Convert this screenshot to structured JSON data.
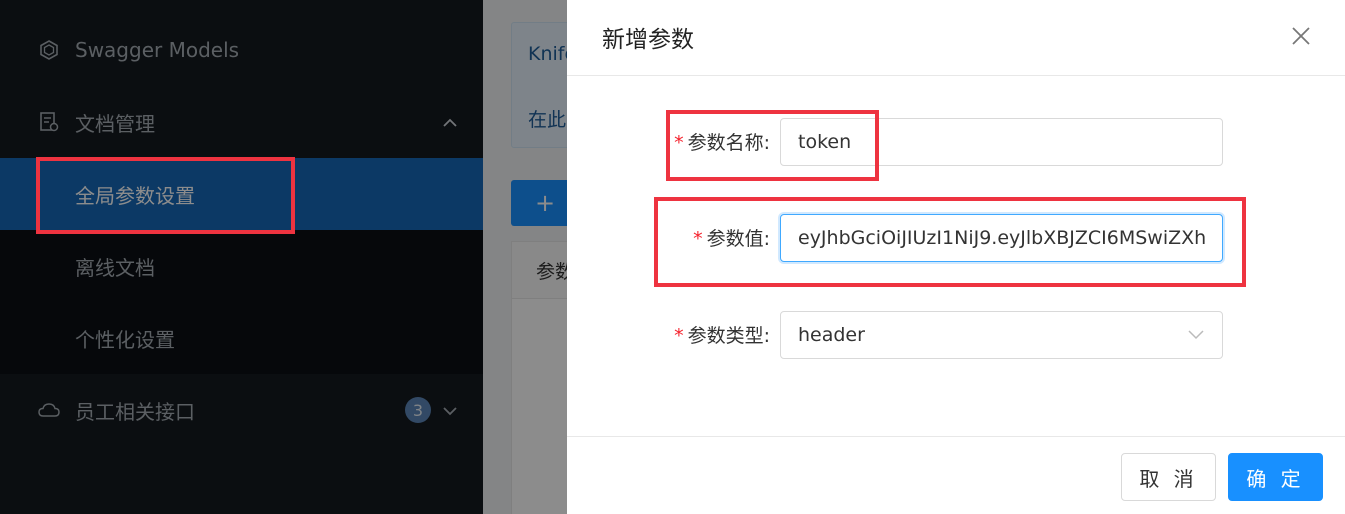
{
  "sidebar": {
    "items": [
      {
        "label": "Swagger Models",
        "icon": "swagger-models-icon"
      },
      {
        "label": "文档管理",
        "icon": "document-manage-icon",
        "expanded": true
      },
      {
        "label": "全局参数设置",
        "active": true
      },
      {
        "label": "离线文档"
      },
      {
        "label": "个性化设置"
      },
      {
        "label": "员工相关接口",
        "icon": "cloud-api-icon",
        "badge": "3"
      }
    ]
  },
  "main": {
    "info_line1": "Knife",
    "info_line2": "在此",
    "add_button": "+",
    "table_header": "参数"
  },
  "modal": {
    "title": "新增参数",
    "fields": {
      "name": {
        "label": "参数名称:",
        "value": "token",
        "required": true
      },
      "value": {
        "label": "参数值:",
        "value": "eyJhbGciOiJIUzI1NiJ9.eyJlbXBJZCI6MSwiZXh",
        "required": true
      },
      "type": {
        "label": "参数类型:",
        "value": "header",
        "required": true
      }
    },
    "required_mark": "*",
    "cancel_label": "取 消",
    "ok_label": "确 定"
  },
  "colors": {
    "sidebar_bg": "#141a1f",
    "active_bg": "#1669b8",
    "primary": "#1890ff",
    "highlight": "#ee3340",
    "required": "#f5222d"
  }
}
